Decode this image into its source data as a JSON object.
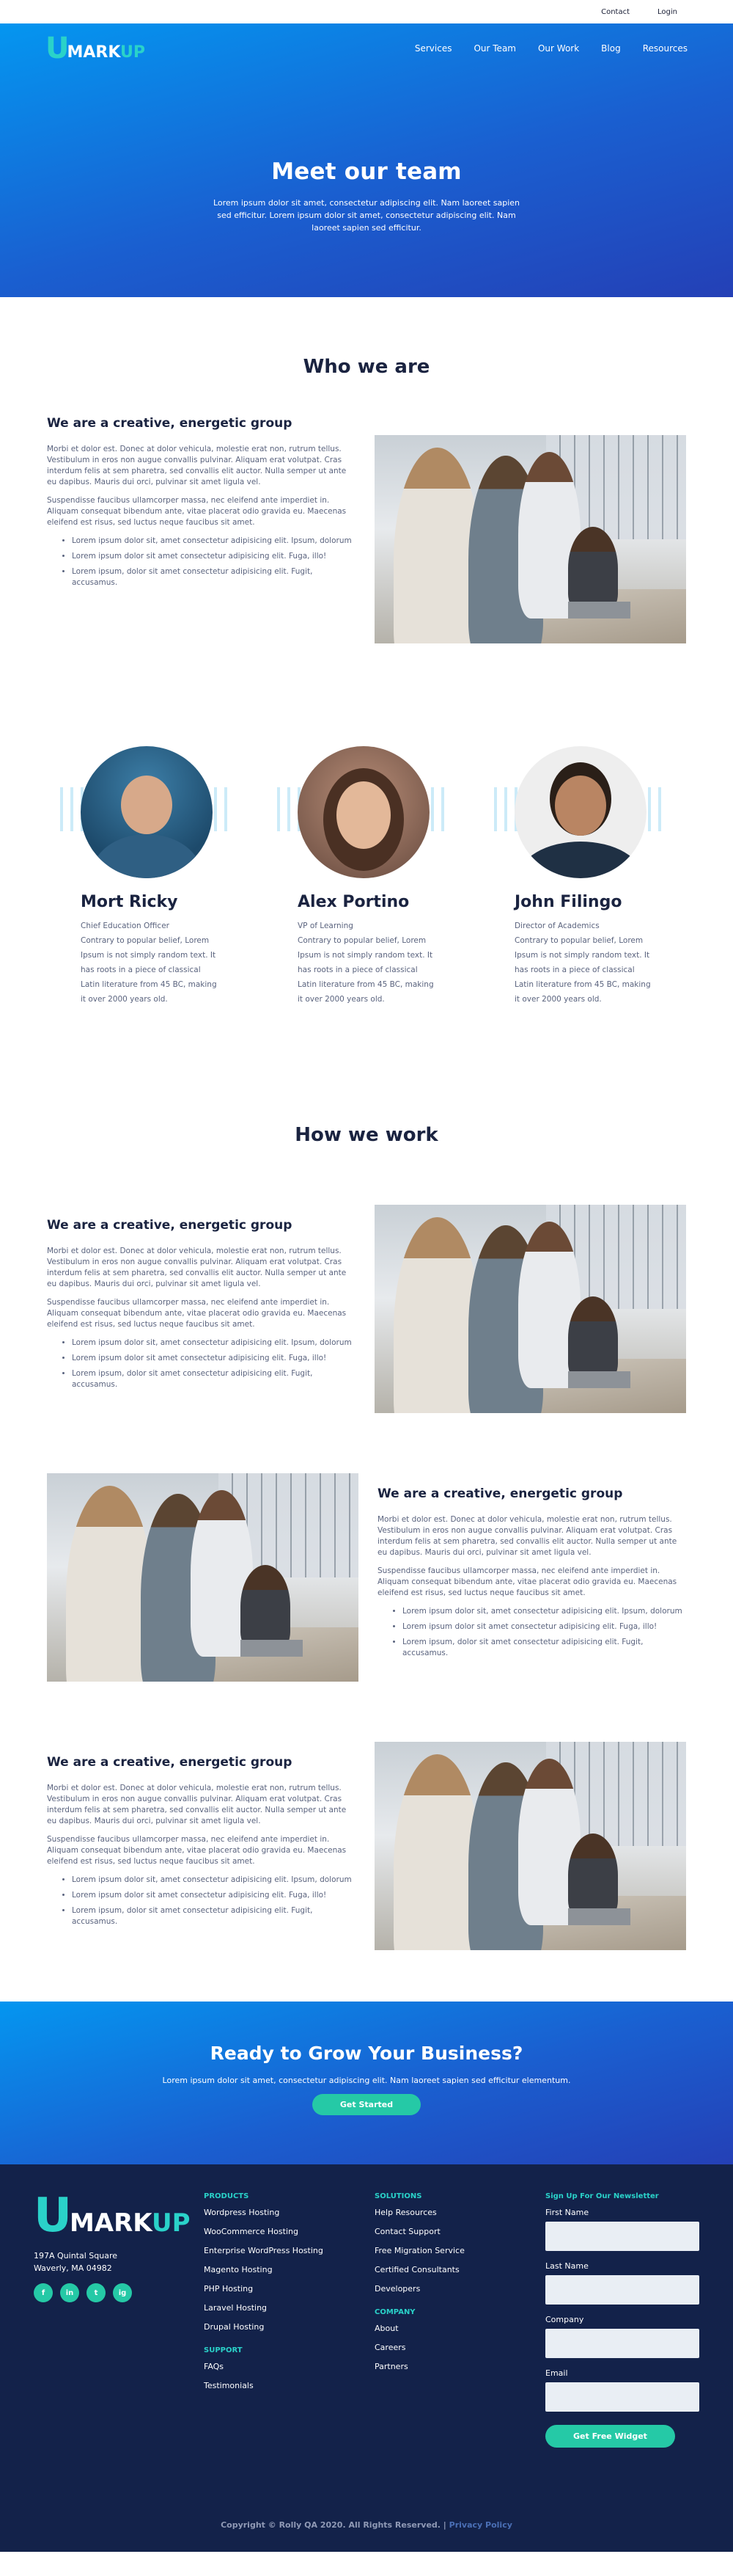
{
  "topbar": {
    "contact": "Contact",
    "login": "Login"
  },
  "logo": {
    "u": "U",
    "mark": "MARK",
    "up": "UP"
  },
  "nav": {
    "items": [
      "Services",
      "Our Team",
      "Our Work",
      "Blog",
      "Resources"
    ]
  },
  "hero": {
    "title": "Meet our team",
    "subtitle": "Lorem ipsum dolor sit amet, consectetur adipiscing elit. Nam laoreet sapien sed efficitur. Lorem ipsum dolor sit amet, consectetur adipiscing elit. Nam laoreet sapien sed efficitur."
  },
  "who": {
    "title": "Who we are",
    "heading": "We are a creative, energetic group",
    "para1": "Morbi et dolor est. Donec at dolor vehicula, molestie erat non, rutrum tellus. Vestibulum in eros non augue convallis pulvinar. Aliquam erat volutpat. Cras interdum felis at sem pharetra, sed convallis elit auctor. Nulla semper ut ante eu dapibus. Mauris dui orci, pulvinar sit amet ligula vel.",
    "para2": "Suspendisse faucibus ullamcorper massa, nec eleifend ante imperdiet in. Aliquam consequat bibendum ante, vitae placerat odio gravida eu. Maecenas eleifend est risus, sed luctus neque faucibus sit amet.",
    "bullets": [
      "Lorem ipsum dolor sit, amet consectetur adipisicing elit. Ipsum, dolorum",
      "Lorem ipsum dolor sit amet consectetur adipisicing elit. Fuga, illo!",
      "Lorem ipsum, dolor sit amet consectetur adipisicing elit. Fugit, accusamus."
    ]
  },
  "team": [
    {
      "name": "Mort Ricky",
      "role": "Chief Education Officer",
      "bio": "Contrary to popular belief, Lorem Ipsum is not simply random text. It has roots in a piece of classical Latin literature from 45 BC, making it over 2000 years old."
    },
    {
      "name": "Alex Portino",
      "role": "VP of Learning",
      "bio": "Contrary to popular belief, Lorem Ipsum is not simply random text. It has roots in a piece of classical Latin literature from 45 BC, making it over 2000 years old."
    },
    {
      "name": "John Filingo",
      "role": "Director of Academics",
      "bio": "Contrary to popular belief, Lorem Ipsum is not simply random text. It has roots in a piece of classical Latin literature from 45 BC, making it over 2000 years old."
    }
  ],
  "how": {
    "title": "How we work"
  },
  "cta": {
    "title": "Ready to Grow Your Business?",
    "subtitle": "Lorem ipsum dolor sit amet, consectetur adipiscing elit. Nam laoreet sapien sed efficitur elementum.",
    "button": "Get Started"
  },
  "footer": {
    "address1": "197A Quintal Square",
    "address2": "Waverly, MA 04982",
    "socials": [
      "f",
      "in",
      "t",
      "ig"
    ],
    "products_head": "PRODUCTS",
    "products": [
      "Wordpress Hosting",
      "WooCommerce Hosting",
      "Enterprise WordPress Hosting",
      "Magento Hosting",
      "PHP Hosting",
      "Laravel Hosting",
      "Drupal Hosting"
    ],
    "support_head": "SUPPORT",
    "support": [
      "FAQs",
      "Testimonials"
    ],
    "solutions_head": "SOLUTIONS",
    "solutions": [
      "Help Resources",
      "Contact Support",
      "Free Migration Service",
      "Certified Consultants",
      "Developers"
    ],
    "company_head": "COMPANY",
    "company": [
      "About",
      "Careers",
      "Partners"
    ],
    "newsletter_head": "Sign Up For Our Newsletter",
    "fields": [
      "First Name",
      "Last Name",
      "Company",
      "Email"
    ],
    "newsletter_button": "Get Free Widget",
    "copyright": "Copyright © Rolly QA 2020. All Rights Reserved. |",
    "privacy": "Privacy Policy"
  },
  "colors": {
    "accent": "#2ad2c9",
    "green": "#25c9a6",
    "hero_start": "#0496f0",
    "hero_end": "#2440b6",
    "footer_bg": "#13224a"
  }
}
